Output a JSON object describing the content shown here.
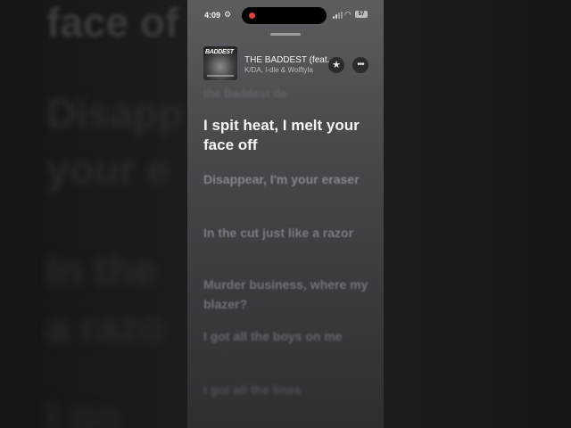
{
  "background": {
    "lines": [
      "face of",
      "Disapp",
      "your e",
      "In the",
      "a razo",
      "I go"
    ]
  },
  "status_bar": {
    "time": "4:09",
    "battery": "57"
  },
  "now_playing": {
    "album_art_text": "BADDEST",
    "title": "THE BADDEST (feat.",
    "artist": "K/DA, I-dle & Wolftyla"
  },
  "lyrics": {
    "previous": "the Baddest da",
    "active": "I spit heat, I melt your face off",
    "upcoming": [
      "Disappear, I'm your eraser",
      "In the cut just like a razor",
      "Murder business, where my blazer?",
      "I got all the boys on me",
      "I got all the lines"
    ]
  },
  "colors": {
    "accent_active": "#f4f4f5",
    "lyric_dim": "#85868b",
    "record_dot": "#e0403a"
  },
  "icons": [
    "gear-icon",
    "signal-icon",
    "wifi-icon",
    "battery-icon",
    "star-icon",
    "more-icon"
  ]
}
